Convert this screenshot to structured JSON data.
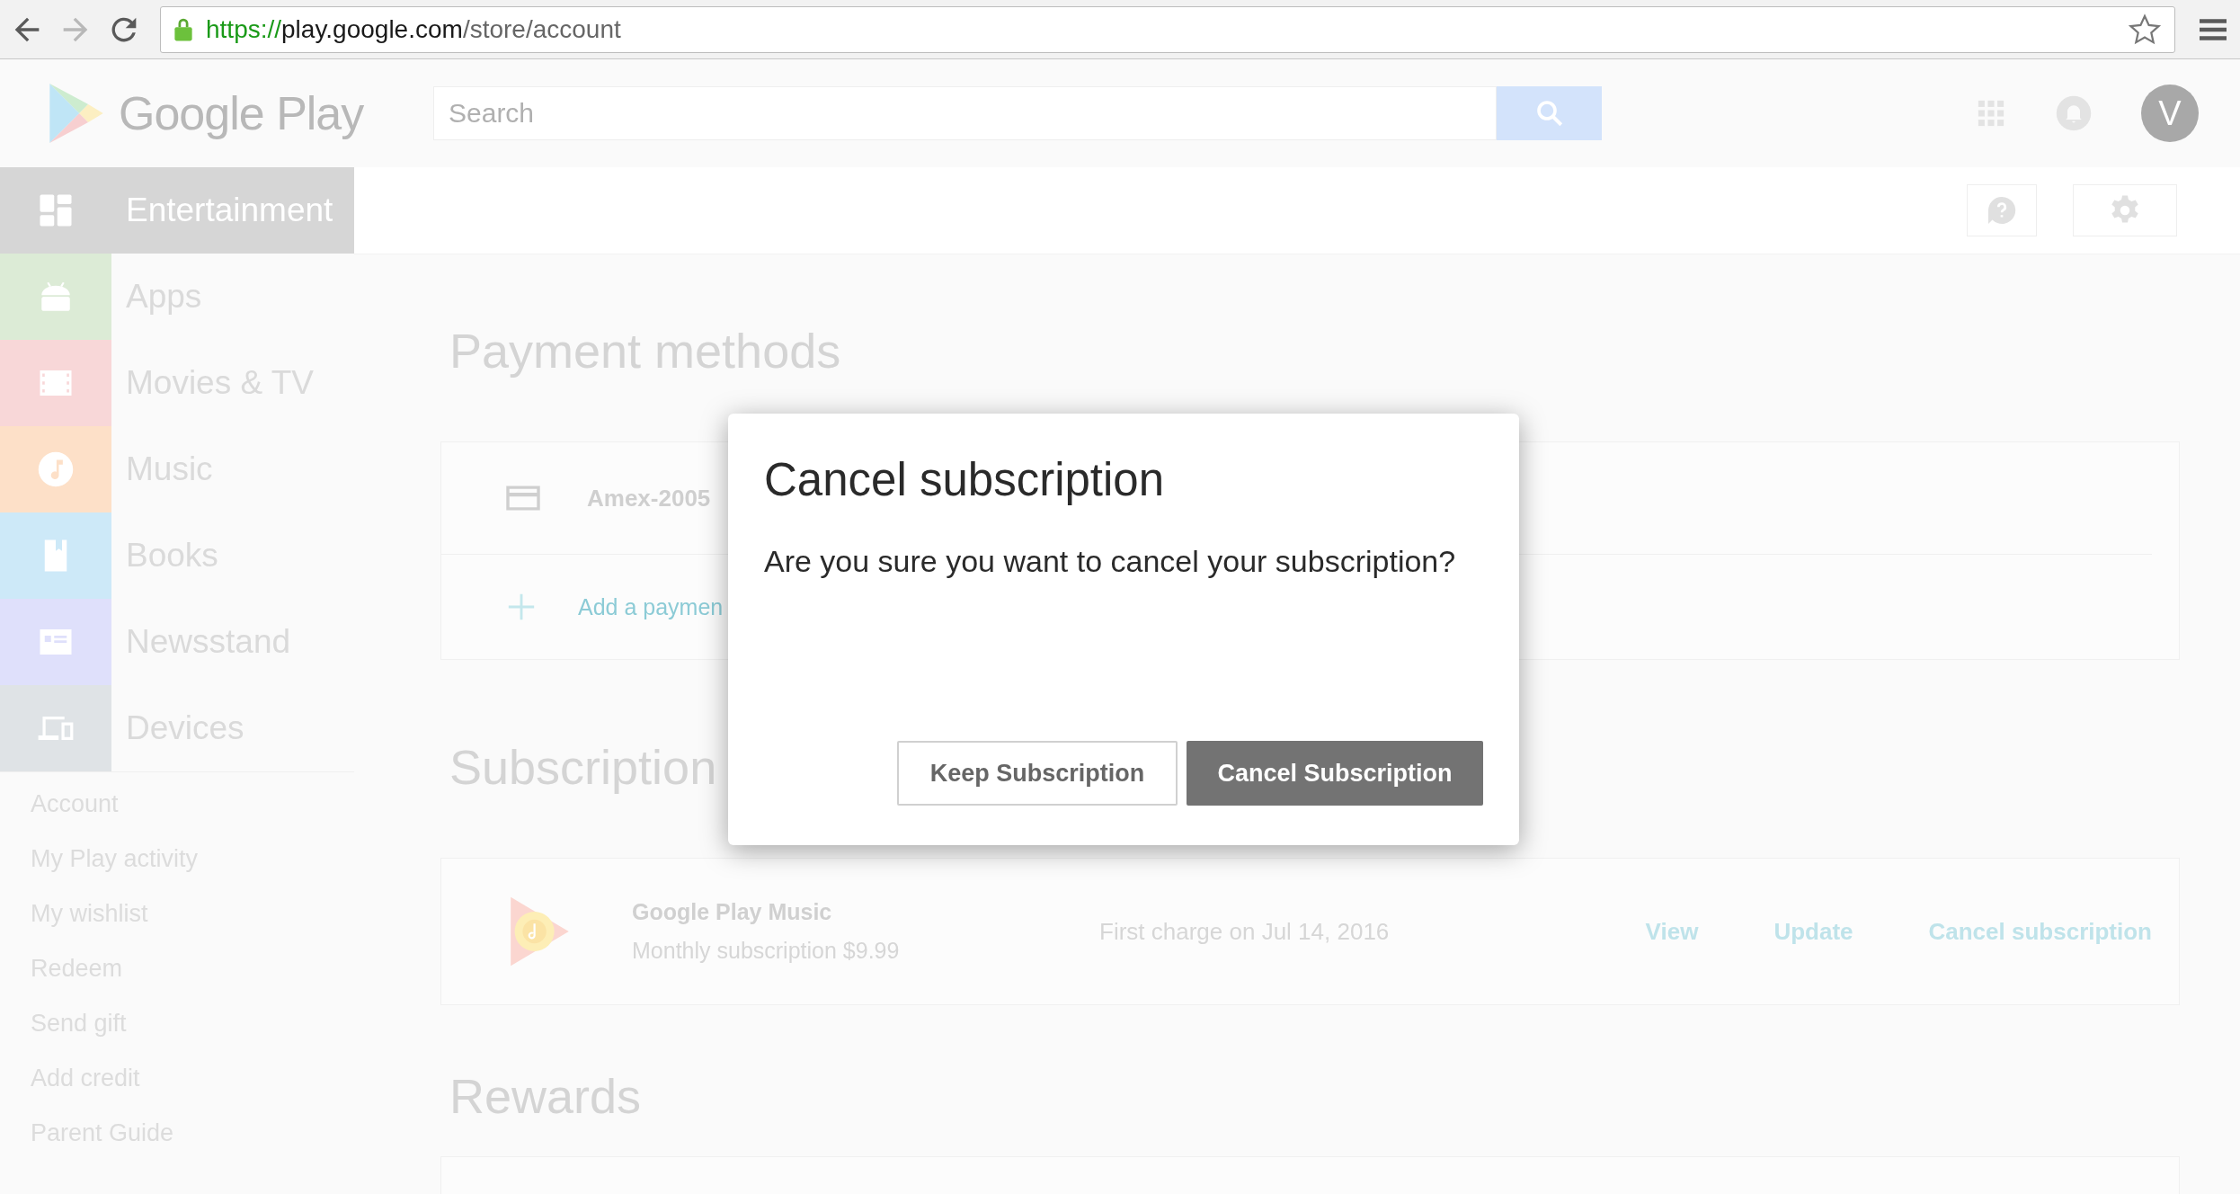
{
  "browser": {
    "url_scheme": "https://",
    "url_host": "play.google.com",
    "url_path": "/store/account"
  },
  "header": {
    "logo": "Google Play",
    "search": {
      "placeholder": "Search"
    },
    "avatar": "V"
  },
  "sidebar": {
    "categories": [
      {
        "label": "Entertainment",
        "kind": "entertainment",
        "color": "#d6d6d6",
        "selected": true
      },
      {
        "label": "Apps",
        "kind": "apps",
        "color": "#dcebd6",
        "selected": false
      },
      {
        "label": "Movies & TV",
        "kind": "movies",
        "color": "#f8d7d8",
        "selected": false
      },
      {
        "label": "Music",
        "kind": "music",
        "color": "#fde0c8",
        "selected": false
      },
      {
        "label": "Books",
        "kind": "books",
        "color": "#cde9f8",
        "selected": false
      },
      {
        "label": "Newsstand",
        "kind": "newsstand",
        "color": "#dfe0fb",
        "selected": false
      },
      {
        "label": "Devices",
        "kind": "devices",
        "color": "#dfe3e6",
        "selected": false
      }
    ],
    "links": [
      "Account",
      "My Play activity",
      "My wishlist",
      "Redeem",
      "Send gift",
      "Add credit",
      "Parent Guide"
    ]
  },
  "payment": {
    "title": "Payment methods",
    "methods": [
      "Amex-2005"
    ],
    "add": "Add a paymen"
  },
  "subscriptions": {
    "title": "Subscription",
    "items": [
      {
        "name": "Google Play Music",
        "detail": "Monthly subscription $9.99",
        "charge": "First charge on Jul 14, 2016",
        "actions": [
          "View",
          "Update",
          "Cancel subscription"
        ]
      }
    ]
  },
  "rewards": {
    "title": "Rewards"
  },
  "dialog": {
    "title": "Cancel subscription",
    "message": "Are you sure you want to cancel your subscription?",
    "buttons": [
      {
        "label": "Keep Subscription",
        "kind": "secondary"
      },
      {
        "label": "Cancel Subscription",
        "kind": "primary"
      }
    ]
  }
}
